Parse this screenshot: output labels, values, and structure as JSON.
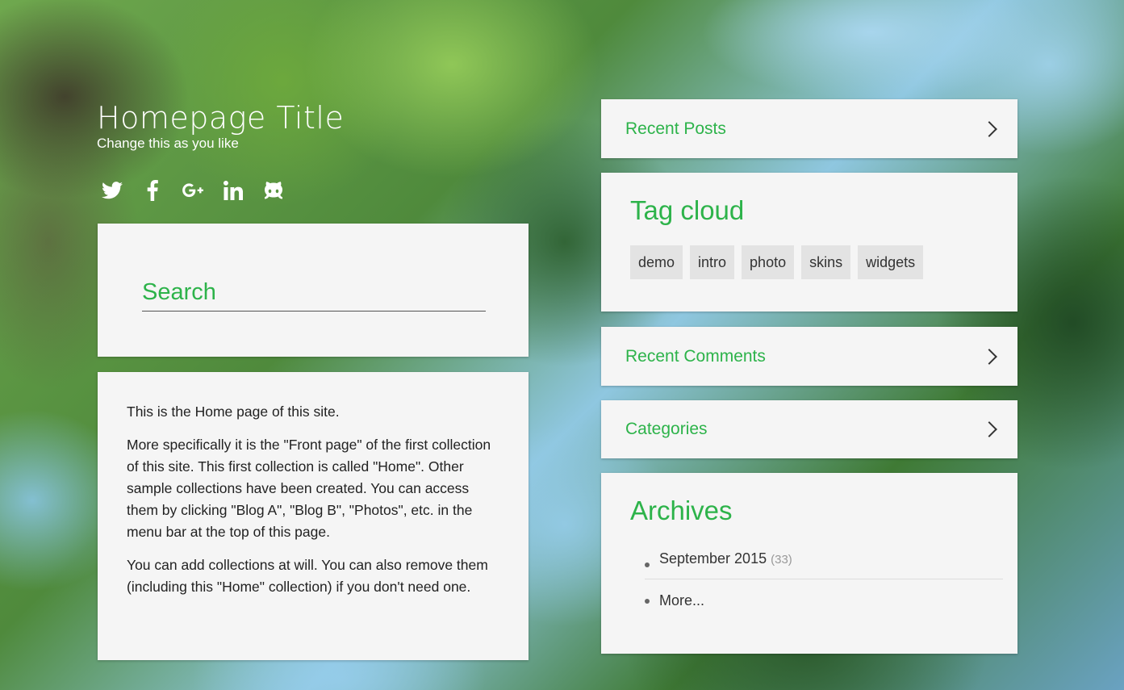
{
  "header": {
    "title": "Homepage Title",
    "tagline": "Change this as you like"
  },
  "social": [
    "twitter-icon",
    "facebook-icon",
    "google-plus-icon",
    "linkedin-icon",
    "github-icon"
  ],
  "search": {
    "placeholder": "Search"
  },
  "content": {
    "paragraphs": [
      "This is the Home page of this site.",
      "More specifically it is the \"Front page\" of the first collection of this site. This first collection is called \"Home\". Other sample collections have been created. You can access them by clicking \"Blog A\", \"Blog B\", \"Photos\", etc. in the menu bar at the top of this page.",
      "You can add collections at will. You can also remove them (including this \"Home\" collection) if you don't need one."
    ]
  },
  "sidebar": {
    "recent_posts": "Recent Posts",
    "tag_cloud": {
      "title": "Tag cloud",
      "tags": [
        "demo",
        "intro",
        "photo",
        "skins",
        "widgets"
      ]
    },
    "recent_comments": "Recent Comments",
    "categories": "Categories",
    "archives": {
      "title": "Archives",
      "items": [
        {
          "label": "September 2015",
          "count": "(33)"
        },
        {
          "label": "More..."
        }
      ]
    }
  },
  "colors": {
    "accent": "#2db34a",
    "panel": "#f5f5f5"
  }
}
